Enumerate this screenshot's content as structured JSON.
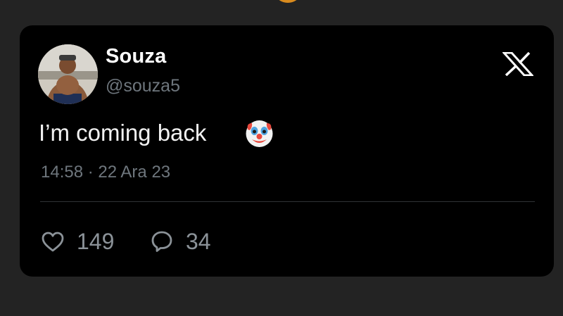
{
  "tweet": {
    "author": {
      "display_name": "Souza",
      "handle": "@souza5"
    },
    "text": "I’m coming back",
    "emoji": "clown-face",
    "timestamp": "14:58 · 22 Ara 23",
    "stats": {
      "likes": "149",
      "replies": "34"
    },
    "platform_logo": "x-logo"
  },
  "colors": {
    "page_background": "#232323",
    "card_background": "#000000",
    "primary_text": "#ffffff",
    "secondary_text": "#6e767d",
    "divider": "#2f3336"
  }
}
